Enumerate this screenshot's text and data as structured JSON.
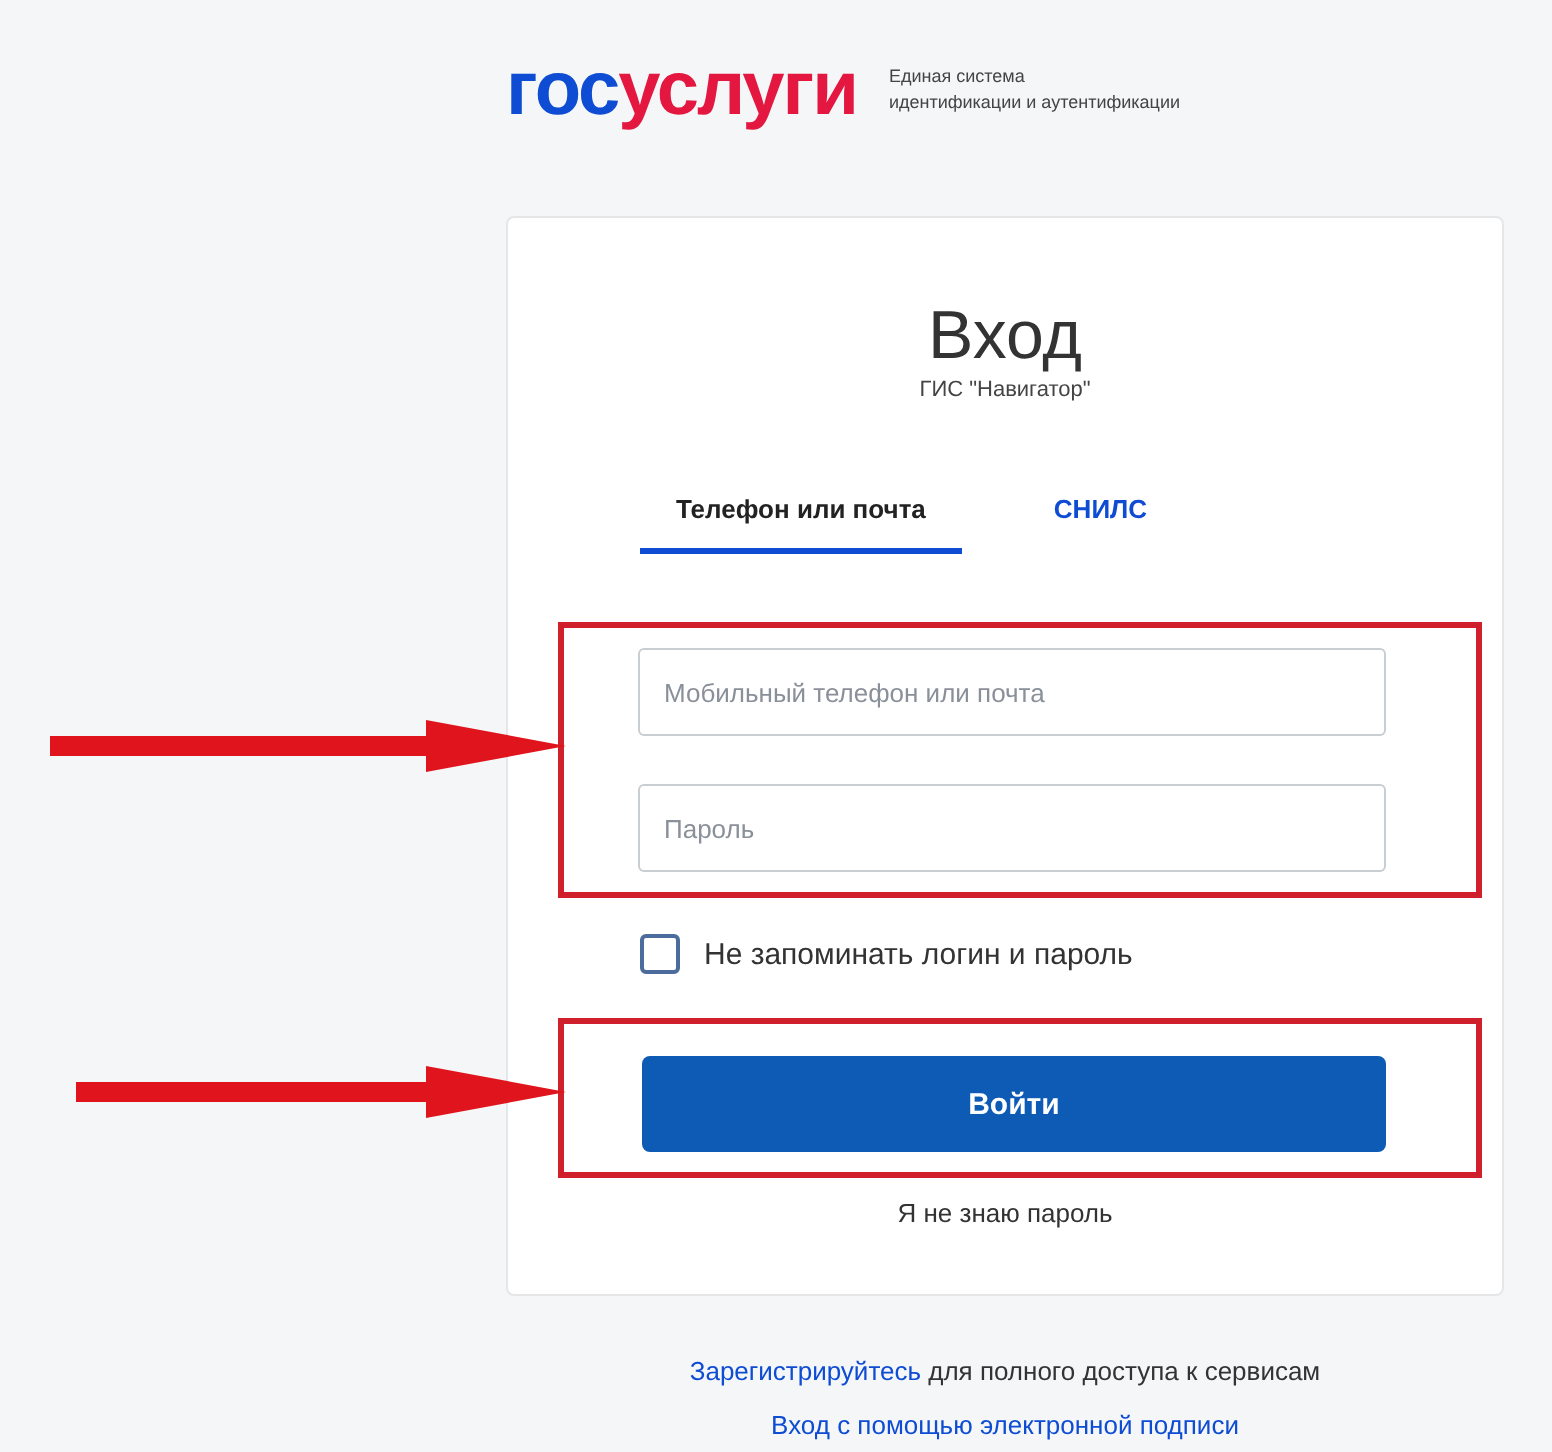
{
  "logo": {
    "part_1": "гос",
    "part_2": "услуги",
    "subtitle_line_1": "Единая система",
    "subtitle_line_2": "идентификации и аутентификации"
  },
  "card": {
    "title": "Вход",
    "subtitle": "ГИС \"Навигатор\"",
    "tabs": [
      {
        "label": "Телефон или почта",
        "selected": true
      },
      {
        "label": "СНИЛС",
        "selected": false
      }
    ],
    "fields": [
      {
        "placeholder": "Мобильный телефон или почта"
      },
      {
        "placeholder": "Пароль"
      }
    ],
    "remember": {
      "label": "Не запоминать логин и пароль",
      "checked": false
    },
    "submit": "Войти",
    "forgot_link": "Я не знаю пароль"
  },
  "footer": {
    "register_link": "Зарегистрируйтесь",
    "register_text": " для полного доступа к сервисам",
    "signature_link": "Вход с помощью электронной подписи"
  }
}
